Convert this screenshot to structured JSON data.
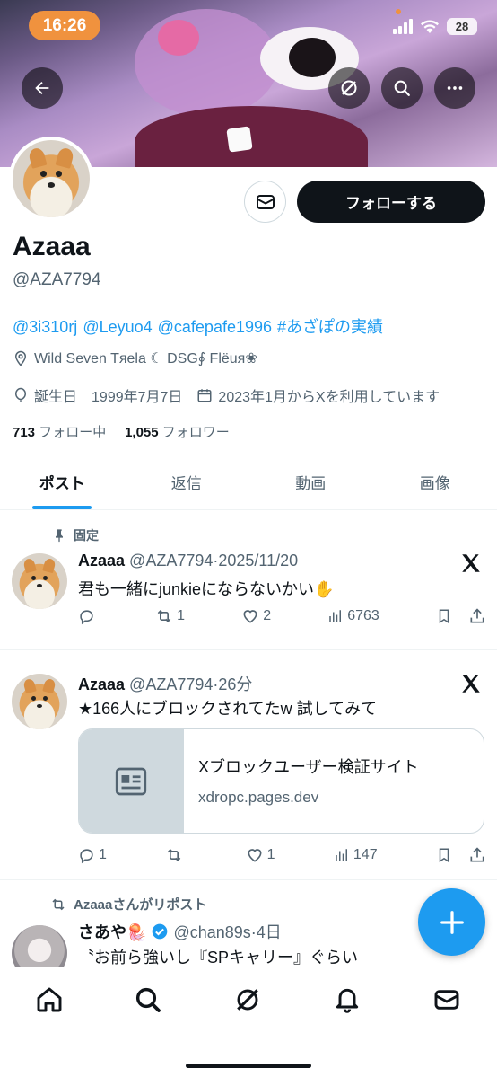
{
  "status_bar": {
    "time": "16:26",
    "battery": "28"
  },
  "profile": {
    "name": "Azaaa",
    "handle": "@AZA7794",
    "follow_label": "フォローする",
    "bio_mentions": [
      "@3i310rj",
      "@Leyuo4",
      "@cafepafe1996",
      "#あざぽの実績"
    ],
    "location": "Wild Seven Tяela ☾ DSG∮ Flëuя❀",
    "birthday_label": "誕生日",
    "birthday": "1999年7月7日",
    "joined": "2023年1月からXを利用しています",
    "following_count": "713",
    "following_label": "フォロー中",
    "followers_count": "1,055",
    "followers_label": "フォロワー"
  },
  "tabs": [
    {
      "label": "ポスト",
      "active": true
    },
    {
      "label": "返信",
      "active": false
    },
    {
      "label": "動画",
      "active": false
    },
    {
      "label": "画像",
      "active": false
    }
  ],
  "tweets": [
    {
      "pinned_label": "固定",
      "name": "Azaaa",
      "handle": "@AZA7794",
      "time": "2025/11/20",
      "text": "君も一緒にjunkieにならないかい✋",
      "replies": "",
      "reposts": "1",
      "likes": "2",
      "views": "6763"
    },
    {
      "name": "Azaaa",
      "handle": "@AZA7794",
      "time": "26分",
      "text": "★166人にブロックされてたw 試してみて",
      "card_title": "Xブロックユーザー検証サイト",
      "card_url": "xdropc.pages.dev",
      "replies": "1",
      "reposts": "",
      "likes": "1",
      "views": "147"
    },
    {
      "repost_label": "Azaaaさんがリポスト",
      "name": "さあや🪼",
      "handle": "@chan89s",
      "time": "4日",
      "text": "〝お前ら強いし『SPキャリー』ぐらい"
    }
  ],
  "colors": {
    "accent": "#1d9bf0",
    "text": "#0f1419",
    "secondary": "#536471",
    "time_pill": "#f0923e"
  }
}
